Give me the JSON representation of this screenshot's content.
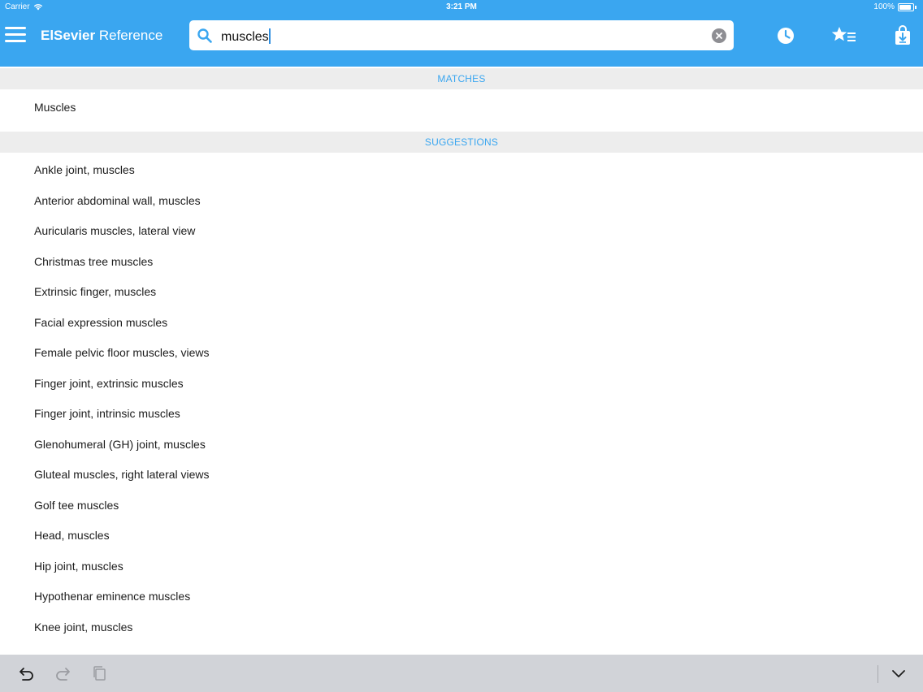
{
  "status_bar": {
    "carrier": "Carrier",
    "time": "3:21 PM",
    "battery": "100%"
  },
  "header": {
    "brand": "ElSevier",
    "title_suffix": "Reference",
    "background_color": "#3aa6f0"
  },
  "search": {
    "value": "muscles",
    "placeholder": ""
  },
  "icons": {
    "menu": "hamburger-menu-icon",
    "history": "clock-icon",
    "favorites": "star-list-icon",
    "downloads": "download-bag-icon",
    "undo": "undo-icon",
    "redo": "redo-icon",
    "paste": "clipboard-icon",
    "hide_keyboard": "chevron-down-icon"
  },
  "sections": {
    "matches_label": "MATCHES",
    "suggestions_label": "SUGGESTIONS"
  },
  "matches": [
    "Muscles"
  ],
  "suggestions": [
    "Ankle joint, muscles",
    "Anterior abdominal wall, muscles",
    "Auricularis muscles, lateral view",
    "Christmas tree muscles",
    "Extrinsic finger, muscles",
    "Facial expression muscles",
    "Female pelvic floor muscles, views",
    "Finger joint, extrinsic muscles",
    "Finger joint, intrinsic muscles",
    "Glenohumeral (GH) joint, muscles",
    "Gluteal muscles, right lateral views",
    "Golf tee muscles",
    "Head, muscles",
    "Hip joint, muscles",
    "Hypothenar eminence muscles",
    "Knee joint, muscles"
  ]
}
